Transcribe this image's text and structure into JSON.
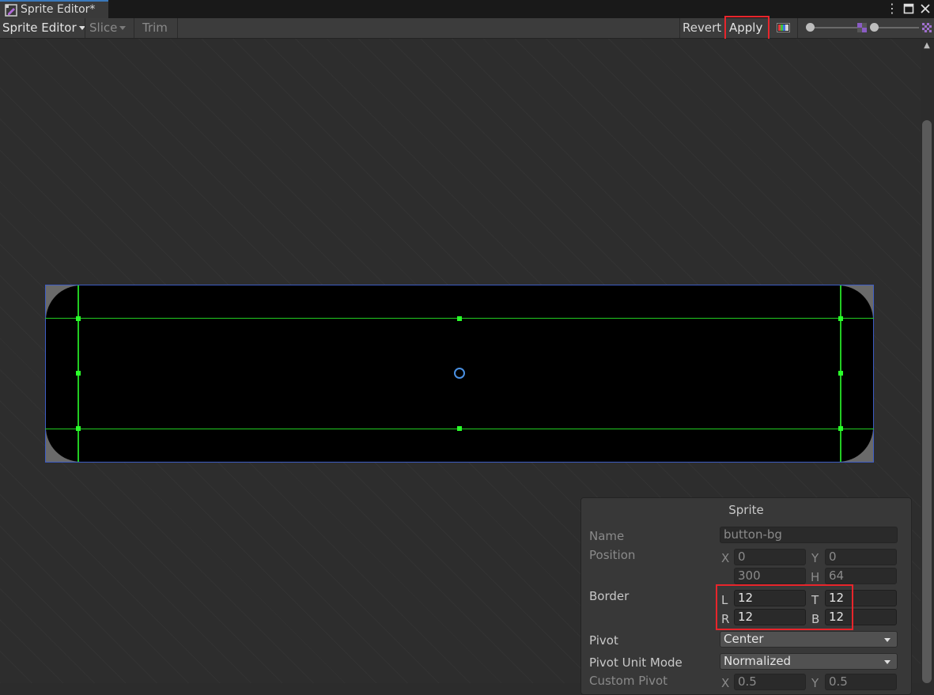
{
  "window": {
    "tab_title": "Sprite Editor*",
    "menu_icon": "kebab-menu-icon",
    "maximize_icon": "maximize-icon",
    "close_icon": "close-icon"
  },
  "toolbar": {
    "mode_label": "Sprite Editor",
    "slice_label": "Slice",
    "trim_label": "Trim",
    "revert_label": "Revert",
    "apply_label": "Apply"
  },
  "inspector": {
    "title": "Sprite",
    "name_label": "Name",
    "name_value": "button-bg",
    "position_label": "Position",
    "x_label": "X",
    "x_value": "0",
    "y_label": "Y",
    "y_value": "0",
    "w_value": "300",
    "h_label": "H",
    "h_value": "64",
    "border_label": "Border",
    "l_label": "L",
    "l_value": "12",
    "t_label": "T",
    "t_value": "12",
    "r_label": "R",
    "r_value": "12",
    "b_label": "B",
    "b_value": "12",
    "pivot_label": "Pivot",
    "pivot_value": "Center",
    "pivot_unit_label": "Pivot Unit Mode",
    "pivot_unit_value": "Normalized",
    "custom_pivot_label": "Custom Pivot",
    "custom_x_label": "X",
    "custom_x_value": "0.5",
    "custom_y_label": "Y",
    "custom_y_value": "0.5"
  },
  "colors": {
    "highlight": "#e8252b",
    "guide": "#22cc22",
    "selection": "#3d5cc4",
    "pivot": "#4a90e2"
  }
}
